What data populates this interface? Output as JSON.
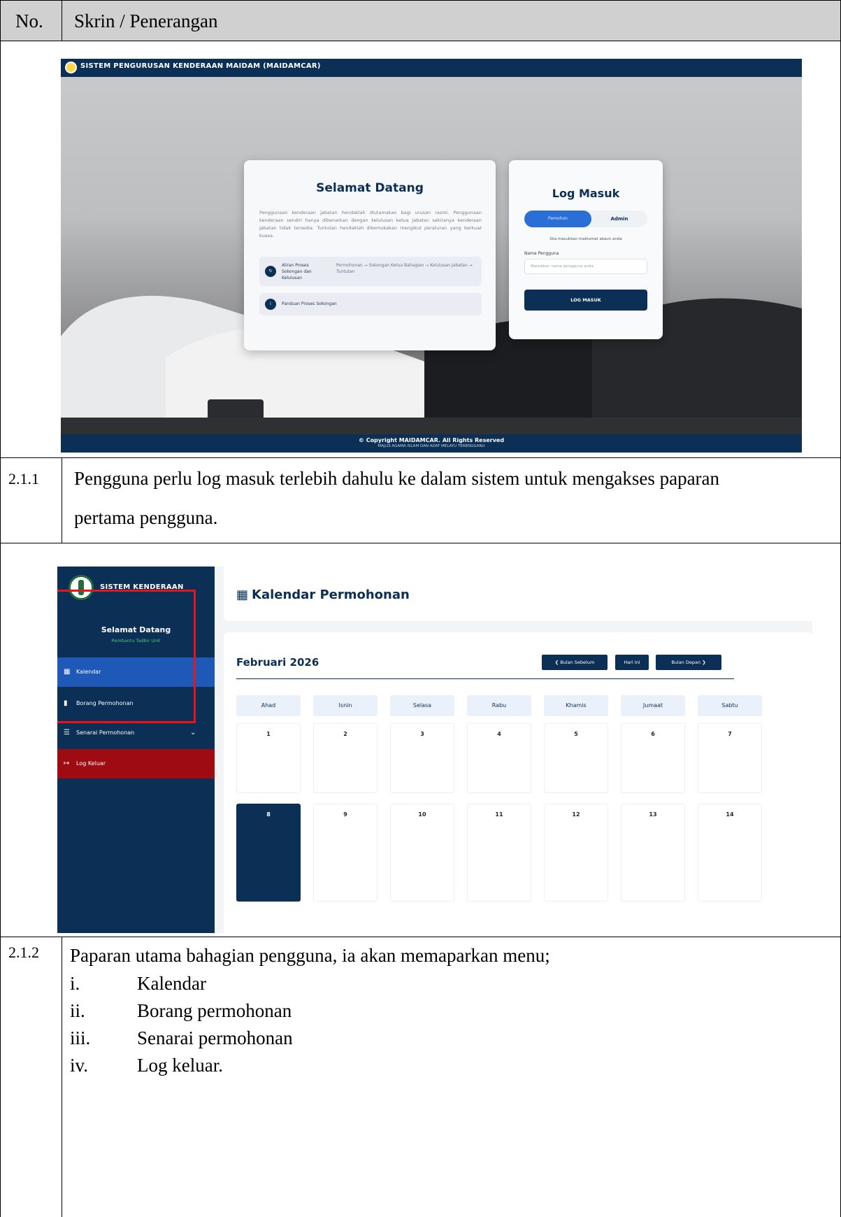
{
  "table": {
    "header": {
      "col1": "No.",
      "col2": "Skrin / Penerangan"
    },
    "rows": [
      {
        "no": "2.1.1",
        "desc_line1": "Pengguna perlu log masuk terlebih dahulu ke dalam sistem untuk mengakses paparan",
        "desc_line2": "pertama pengguna."
      },
      {
        "no": "2.1.2",
        "desc_intro": "Paparan utama bahagian pengguna, ia akan memaparkan menu;",
        "menu": [
          {
            "num": "i.",
            "text": "Kalendar"
          },
          {
            "num": "ii.",
            "text": "Borang permohonan"
          },
          {
            "num": "iii.",
            "text": "Senarai permohonan"
          },
          {
            "num": "iv.",
            "text": "Log keluar."
          }
        ]
      }
    ]
  },
  "login_screen": {
    "app_title": "SISTEM PENGURUSAN KENDERAAN MAIDAM (MAIDAMCAR)",
    "welcome_title": "Selamat Datang",
    "welcome_text": "Penggunaan kenderaan jabatan hendaklah diutamakan bagi urusan rasmi. Penggunaan kenderaan sendiri hanya dibenarkan dengan kelulusan ketua jabatan sekiranya kenderaan jabatan tidak tersedia. Tuntutan hendaklah dikemukakan mengikut peraturan yang berkuat kuasa.",
    "flow_label": "Aliran Proses Sokongan dan Kelulusan",
    "flow_steps": "Permohonan → Sokongan Ketua Bahagian → Kelulusan Jabatan → Tuntutan",
    "guide_label": "Panduan Proses Sokongan",
    "login_title": "Log Masuk",
    "tab_user": "Pemohon",
    "tab_admin": "Admin",
    "hint": "Sila masukkan maklumat akaun anda",
    "username_label": "Nama Pengguna",
    "username_placeholder": "Masukkan nama pengguna anda",
    "login_button": "LOG MASUK",
    "footer_copyright": "© Copyright MAIDAMCAR. All Rights Reserved",
    "footer_org": "MAJLIS AGAMA ISLAM DAN ADAT MELAYU TERENGGANU"
  },
  "dashboard_screen": {
    "brand": "SISTEM KENDERAAN",
    "welcome": "Selamat Datang",
    "role": "Pembantu Tadbir Unit",
    "menu": [
      {
        "label": "Kalendar",
        "icon": "calendar-icon"
      },
      {
        "label": "Borang Permohonan",
        "icon": "file-icon"
      },
      {
        "label": "Senarai Permohonan",
        "icon": "list-icon"
      },
      {
        "label": "Log Keluar",
        "icon": "logout-icon"
      }
    ],
    "page_title": "Kalendar Permohonan",
    "month": "Februari 2026",
    "btn_prev": "❮ Bulan Sebelum",
    "btn_today": "Hari Ini",
    "btn_next": "Bulan Depan ❯",
    "weekdays": [
      "Ahad",
      "Isnin",
      "Selasa",
      "Rabu",
      "Khamis",
      "Jumaat",
      "Sabtu"
    ],
    "week1": [
      "1",
      "2",
      "3",
      "4",
      "5",
      "6",
      "7"
    ],
    "week2": [
      "8",
      "9",
      "10",
      "11",
      "12",
      "13",
      "14"
    ],
    "today": "8"
  }
}
